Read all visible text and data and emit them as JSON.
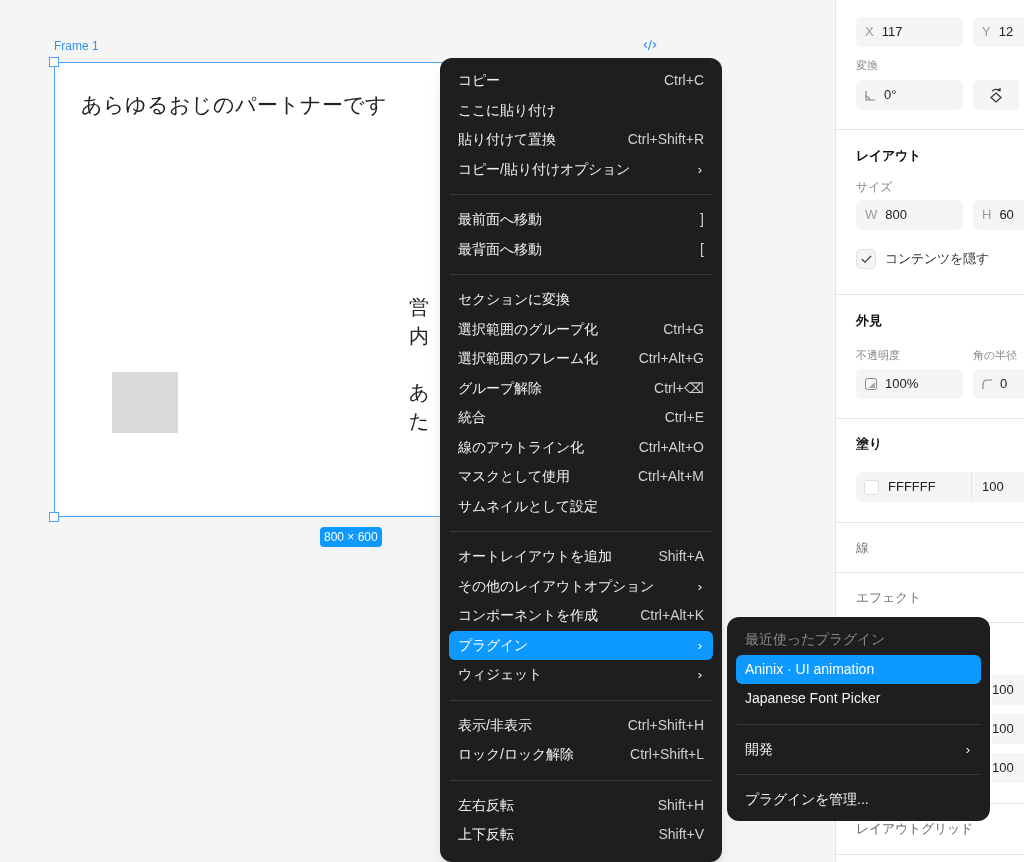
{
  "canvas": {
    "frame": {
      "label": "Frame 1",
      "size_badge": "800 × 600",
      "heading": "あらゆるおじのパートナーです",
      "column_text": [
        [
          "営",
          "内"
        ],
        [
          "あ",
          "た"
        ]
      ]
    }
  },
  "context_menu": {
    "groups": [
      [
        {
          "label": "コピー",
          "shortcut": "Ctrl+C",
          "selected": false
        },
        {
          "label": "ここに貼り付け",
          "selected": false
        },
        {
          "label": "貼り付けて置換",
          "shortcut": "Ctrl+Shift+R",
          "selected": false
        },
        {
          "label": "コピー/貼り付けオプション",
          "arrow": "›",
          "selected": false
        }
      ],
      [
        {
          "label": "最前面へ移動",
          "shortcut": "]",
          "selected": false
        },
        {
          "label": "最背面へ移動",
          "shortcut": "[",
          "selected": false
        }
      ],
      [
        {
          "label": "セクションに変換",
          "selected": false
        },
        {
          "label": "選択範囲のグループ化",
          "shortcut": "Ctrl+G",
          "selected": false
        },
        {
          "label": "選択範囲のフレーム化",
          "shortcut": "Ctrl+Alt+G",
          "selected": false
        },
        {
          "label": "グループ解除",
          "shortcut": "Ctrl+⌫",
          "selected": false
        },
        {
          "label": "統合",
          "shortcut": "Ctrl+E",
          "selected": false
        },
        {
          "label": "線のアウトライン化",
          "shortcut": "Ctrl+Alt+O",
          "selected": false
        },
        {
          "label": "マスクとして使用",
          "shortcut": "Ctrl+Alt+M",
          "selected": false
        },
        {
          "label": "サムネイルとして設定",
          "selected": false
        }
      ],
      [
        {
          "label": "オートレイアウトを追加",
          "shortcut": "Shift+A",
          "selected": false
        },
        {
          "label": "その他のレイアウトオプション",
          "arrow": "›",
          "selected": false
        },
        {
          "label": "コンポーネントを作成",
          "shortcut": "Ctrl+Alt+K",
          "selected": false
        },
        {
          "label": "プラグイン",
          "arrow": "›",
          "selected": true
        },
        {
          "label": "ウィジェット",
          "arrow": "›",
          "selected": false
        }
      ],
      [
        {
          "label": "表示/非表示",
          "shortcut": "Ctrl+Shift+H",
          "selected": false
        },
        {
          "label": "ロック/ロック解除",
          "shortcut": "Ctrl+Shift+L",
          "selected": false
        }
      ],
      [
        {
          "label": "左右反転",
          "shortcut": "Shift+H",
          "selected": false
        },
        {
          "label": "上下反転",
          "shortcut": "Shift+V",
          "selected": false
        }
      ]
    ]
  },
  "submenu": {
    "header": "最近使ったプラグイン",
    "groups": [
      [
        {
          "label": "Aninix · UI animation",
          "selected": true
        },
        {
          "label": "Japanese Font Picker",
          "selected": false
        }
      ],
      [
        {
          "label": "開発",
          "arrow": "›",
          "selected": false
        }
      ],
      [
        {
          "label": "プラグインを管理...",
          "selected": false
        }
      ]
    ]
  },
  "properties": {
    "position": {
      "x": {
        "axis": "X",
        "value": "117"
      },
      "y": {
        "axis": "Y",
        "value": "12"
      }
    },
    "transform": {
      "label": "変換",
      "rotation": "0°"
    },
    "layout": {
      "title": "レイアウト",
      "size_label": "サイズ",
      "w": {
        "axis": "W",
        "value": "800"
      },
      "h": {
        "axis": "H",
        "value": "60"
      },
      "clip": {
        "label": "コンテンツを隠す",
        "checked": true
      }
    },
    "appearance": {
      "title": "外見",
      "opacity_label": "不透明度",
      "opacity": "100%",
      "radius_label": "角の半径",
      "radius": "0"
    },
    "fill": {
      "title": "塗り",
      "hex": "FFFFFF",
      "opacity": "100"
    },
    "stroke": {
      "title": "線"
    },
    "effects": {
      "title": "エフェクト"
    },
    "hidden_section_values": [
      "100",
      "100",
      "100"
    ],
    "layout_grid": {
      "title": "レイアウトグリッド"
    }
  }
}
